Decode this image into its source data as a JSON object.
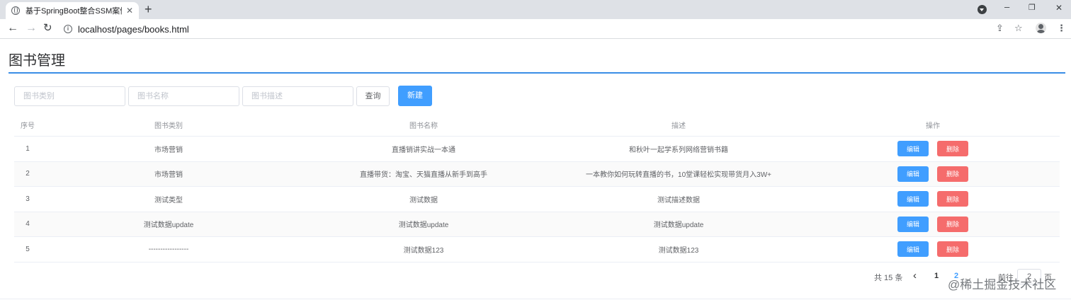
{
  "browser": {
    "tab_title": "基于SpringBoot整合SSM案例",
    "tab_close": "✕",
    "new_tab": "+",
    "url": "localhost/pages/books.html",
    "window_controls": {
      "minimize": "–",
      "restore": "❐",
      "close": "✕"
    }
  },
  "page": {
    "title": "图书管理"
  },
  "filters": {
    "category_placeholder": "图书类别",
    "name_placeholder": "图书名称",
    "description_placeholder": "图书描述",
    "query_label": "查询",
    "new_label": "新建"
  },
  "table": {
    "headers": {
      "index": "序号",
      "category": "图书类别",
      "name": "图书名称",
      "description": "描述",
      "operations": "操作"
    },
    "rows": [
      {
        "index": "1",
        "category": "市场营销",
        "name": "直播销讲实战一本通",
        "description": "和秋叶一起学系列网络营销书籍"
      },
      {
        "index": "2",
        "category": "市场营销",
        "name": "直播带货：淘宝、天猫直播从新手到高手",
        "description": "一本教你如何玩转直播的书，10堂课轻松实现带货月入3W+"
      },
      {
        "index": "3",
        "category": "测试类型",
        "name": "测试数据",
        "description": "测试描述数据"
      },
      {
        "index": "4",
        "category": "测试数据update",
        "name": "测试数据update",
        "description": "测试数据update"
      },
      {
        "index": "5",
        "category": "-----------------",
        "name": "测试数据123",
        "description": "测试数据123"
      }
    ],
    "edit_label": "编辑",
    "delete_label": "删除"
  },
  "pagination": {
    "total": "共 15 条",
    "prev": "‹",
    "current_page": "1",
    "next_page": "2",
    "goto_label": "前往",
    "goto_value": "2",
    "page_suffix": "页"
  },
  "watermark": "@稀土掘金技术社区",
  "colors": {
    "primary": "#409eff",
    "danger": "#f56c6c",
    "title_line": "#3a8ee6"
  }
}
